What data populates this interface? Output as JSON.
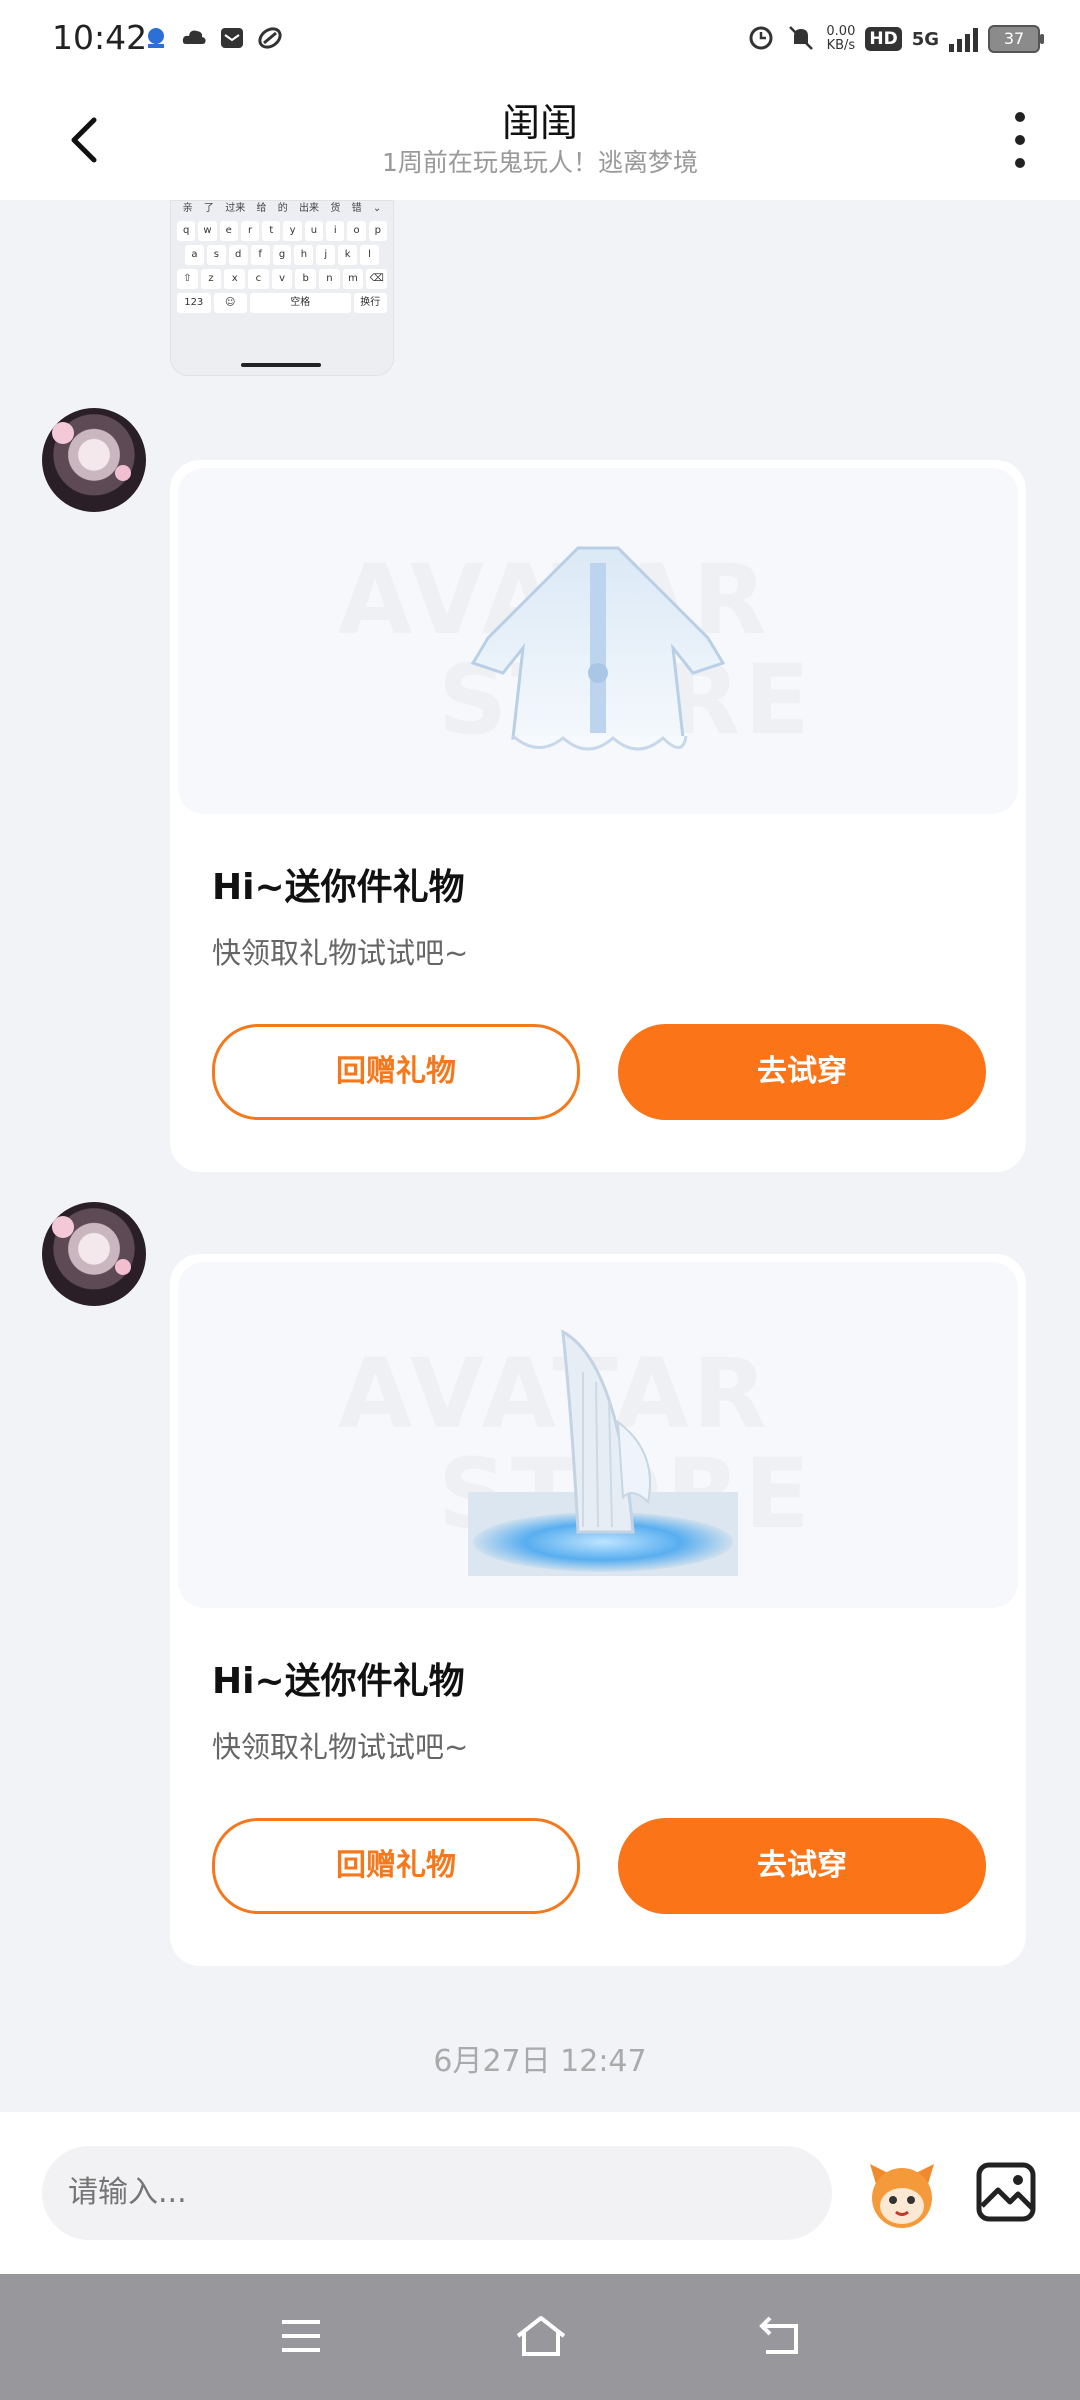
{
  "status_bar": {
    "time": "10:42",
    "net_speed_value": "0.00",
    "net_speed_unit": "KB/s",
    "hd_label": "HD",
    "network_type": "5G",
    "battery_level": "37"
  },
  "header": {
    "title": "闺闺",
    "subtitle": "1周前在玩鬼玩人！逃离梦境"
  },
  "keyboard_image": {
    "candidates": [
      "亲",
      "了",
      "过来",
      "给",
      "的",
      "出来",
      "货",
      "错",
      "⌄"
    ],
    "row1": [
      "q",
      "w",
      "e",
      "r",
      "t",
      "y",
      "u",
      "i",
      "o",
      "p"
    ],
    "row2": [
      "a",
      "s",
      "d",
      "f",
      "g",
      "h",
      "j",
      "k",
      "l"
    ],
    "row3": [
      "⇧",
      "z",
      "x",
      "c",
      "v",
      "b",
      "n",
      "m",
      "⌫"
    ],
    "row4": [
      "123",
      "☺",
      "空格",
      "换行"
    ]
  },
  "messages": [
    {
      "title": "Hi~送你件礼物",
      "subtitle": "快领取礼物试试吧~",
      "watermark_line1": "AVATAR",
      "watermark_line2": "STORE",
      "return_gift_label": "回赠礼物",
      "try_on_label": "去试穿"
    },
    {
      "title": "Hi~送你件礼物",
      "subtitle": "快领取礼物试试吧~",
      "watermark_line1": "AVATAR",
      "watermark_line2": "STORE",
      "return_gift_label": "回赠礼物",
      "try_on_label": "去试穿"
    }
  ],
  "timestamp": "6月27日 12:47",
  "input": {
    "placeholder": "请输入..."
  },
  "colors": {
    "accent": "#fb7417",
    "background": "#f1f3f7",
    "navbar": "#98979b"
  },
  "icons": {
    "back": "back-arrow-icon",
    "more": "more-vertical-icon",
    "emoji": "mascot-emoji-icon",
    "image": "image-icon",
    "nav_menu": "menu-icon",
    "nav_home": "home-icon",
    "nav_back": "return-icon"
  }
}
